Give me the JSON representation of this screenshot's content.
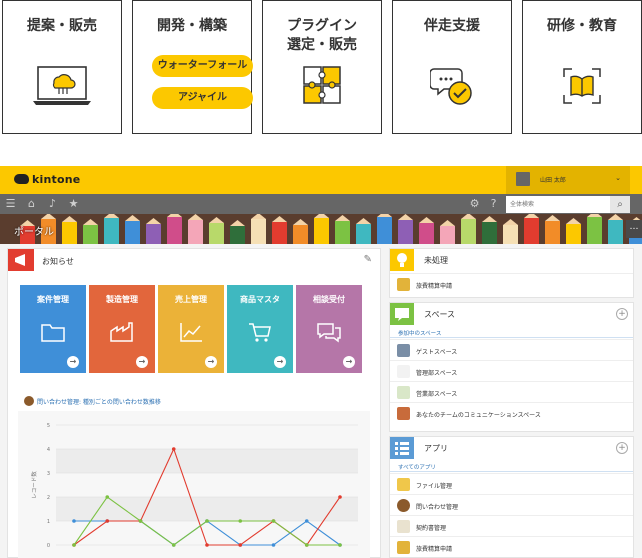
{
  "services": [
    {
      "title": "提案・販売"
    },
    {
      "title": "開発・構築",
      "pills": [
        "ウォーターフォール",
        "アジャイル"
      ]
    },
    {
      "title": "プラグイン\n選定・販売"
    },
    {
      "title": "伴走支援"
    },
    {
      "title": "研修・教育"
    }
  ],
  "app": {
    "logo": "kintone",
    "user_name": "山田 太郎",
    "search_placeholder": "全体検索",
    "portal_label": "ポータル",
    "notice": {
      "title": "お知らせ",
      "tiles": [
        {
          "label": "案件管理",
          "color": "#3f8fd8"
        },
        {
          "label": "製造管理",
          "color": "#e2663c"
        },
        {
          "label": "売上管理",
          "color": "#ebb238"
        },
        {
          "label": "商品マスタ",
          "color": "#3fb8c0"
        },
        {
          "label": "相談受付",
          "color": "#b576a8"
        }
      ],
      "chart_heading": "問い合わせ管理: 種別ごとの問い合わせ数推移"
    },
    "unprocessed": {
      "title": "未処理",
      "items": [
        "旅費精算申請"
      ]
    },
    "spaces": {
      "title": "スペース",
      "subheader": "参加中のスペース",
      "items": [
        "ゲストスペース",
        "管理部スペース",
        "営業部スペース",
        "あなたのチームのコミュニケーションスペース"
      ]
    },
    "apps": {
      "title": "アプリ",
      "subheader": "すべてのアプリ",
      "items": [
        "ファイル管理",
        "問い合わせ管理",
        "契約書管理",
        "旅費精算申請"
      ]
    }
  },
  "chart_data": {
    "type": "line",
    "ylabel": "レコード数",
    "yticks": [
      "0",
      "1",
      "2",
      "3",
      "4",
      "5"
    ],
    "ylim": [
      0,
      5
    ],
    "grid": true,
    "x": [
      1,
      2,
      3,
      4,
      5,
      6,
      7,
      8,
      9
    ],
    "series": [
      {
        "color": "#3f8fd8",
        "values": [
          1,
          1,
          1,
          0,
          1,
          0,
          0,
          1,
          0
        ]
      },
      {
        "color": "#e23c2f",
        "values": [
          0,
          1,
          1,
          4,
          0,
          0,
          1,
          0,
          2
        ]
      },
      {
        "color": "#7cc243",
        "values": [
          0,
          2,
          1,
          0,
          1,
          1,
          1,
          0,
          0
        ]
      }
    ]
  }
}
